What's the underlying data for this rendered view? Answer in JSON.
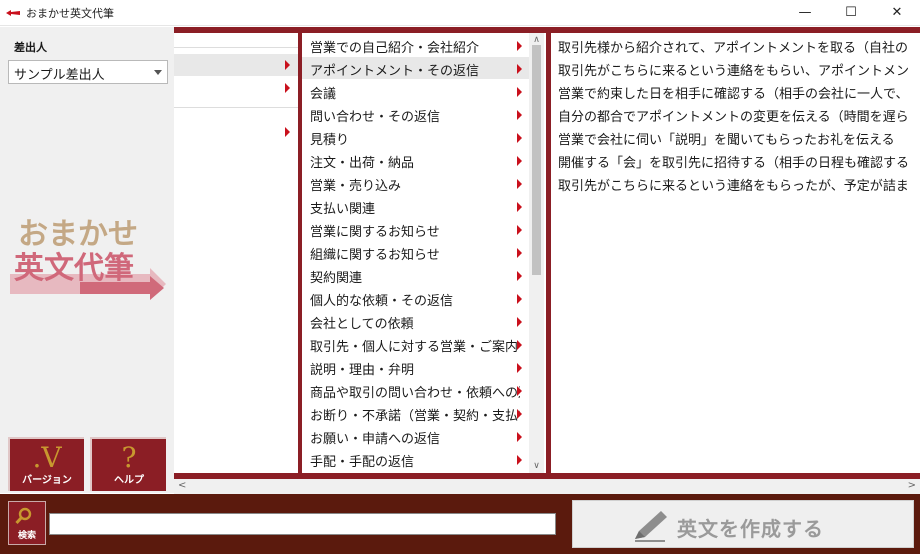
{
  "window": {
    "title": "おまかせ英文代筆",
    "minimize": "—",
    "maximize": "☐",
    "close": "✕"
  },
  "sidebar": {
    "sender_label": "差出人",
    "sender_value": "サンプル差出人",
    "logo_line1": "おまかせ",
    "logo_line2": "英文代筆",
    "version_glyph": ".V",
    "version_label": "バージョン",
    "help_glyph": "?",
    "help_label": "ヘルプ"
  },
  "column2": {
    "items": [
      {
        "label": "営業での自己紹介・会社紹介"
      },
      {
        "label": "アポイントメント・その返信"
      },
      {
        "label": "会議"
      },
      {
        "label": "問い合わせ・その返信"
      },
      {
        "label": "見積り"
      },
      {
        "label": "注文・出荷・納品"
      },
      {
        "label": "営業・売り込み"
      },
      {
        "label": "支払い関連"
      },
      {
        "label": "営業に関するお知らせ"
      },
      {
        "label": "組織に関するお知らせ"
      },
      {
        "label": "契約関連"
      },
      {
        "label": "個人的な依頼・その返信"
      },
      {
        "label": "会社としての依頼"
      },
      {
        "label": "取引先・個人に対する営業・ご案内"
      },
      {
        "label": "説明・理由・弁明"
      },
      {
        "label": "商品や取引の問い合わせ・依頼への返"
      },
      {
        "label": "お断り・不承諾（営業・契約・支払い"
      },
      {
        "label": "お願い・申請への返信"
      },
      {
        "label": "手配・手配の返信"
      }
    ],
    "selected_index": 1,
    "scroll_up": "∧",
    "scroll_down": "∨"
  },
  "column3": {
    "items": [
      {
        "label": "取引先様から紹介されて、アポイントメントを取る（自社の"
      },
      {
        "label": "取引先がこちらに来るという連絡をもらい、アポイントメン"
      },
      {
        "label": "営業で約束した日を相手に確認する（相手の会社に一人で、"
      },
      {
        "label": "自分の都合でアポイントメントの変更を伝える（時間を遅ら"
      },
      {
        "label": "営業で会社に伺い「説明」を聞いてもらったお礼を伝える"
      },
      {
        "label": "開催する「会」を取引先に招待する（相手の日程も確認する"
      },
      {
        "label": "取引先がこちらに来るという連絡をもらったが、予定が詰ま"
      }
    ]
  },
  "hscroll": {
    "left": "<",
    "right": ">"
  },
  "bottom": {
    "search_label": "検索",
    "search_value": "",
    "create_label": "英文を作成する"
  },
  "colors": {
    "accent": "#8b1e25",
    "bottom_bar": "#5b1a0d",
    "arrow": "#c9101c"
  }
}
